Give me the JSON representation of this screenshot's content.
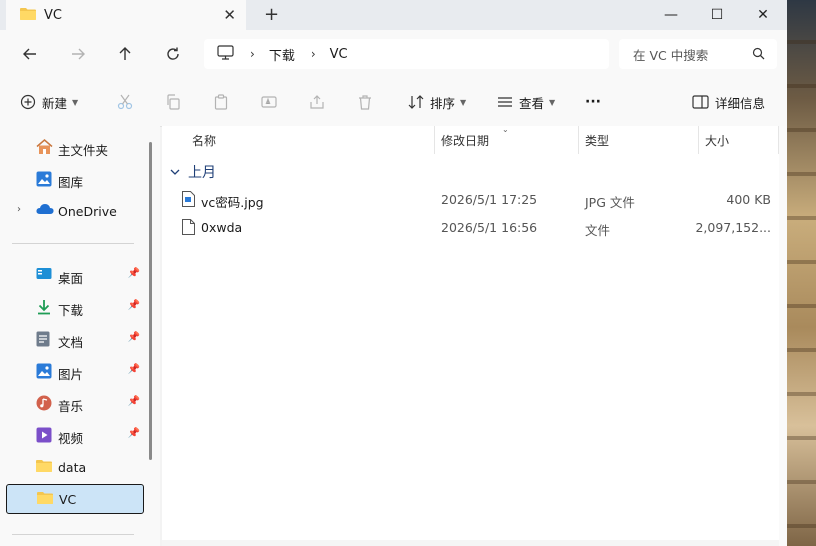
{
  "window": {
    "tab_title": "VC",
    "tab_close": "✕",
    "new_tab": "+",
    "min": "—",
    "max": "☐",
    "close": "✕"
  },
  "address": {
    "crumbs": [
      "下载",
      "VC"
    ],
    "sep": "›"
  },
  "search": {
    "placeholder": "在 VC 中搜索"
  },
  "toolbar": {
    "new_label": "新建",
    "sort_label": "排序",
    "view_label": "查看",
    "more_label": "···",
    "details_label": "详细信息"
  },
  "sidebar": {
    "home": "主文件夹",
    "gallery": "图库",
    "onedrive": "OneDrive",
    "pinned": [
      {
        "label": "桌面"
      },
      {
        "label": "下载"
      },
      {
        "label": "文档"
      },
      {
        "label": "图片"
      },
      {
        "label": "音乐"
      },
      {
        "label": "视频"
      }
    ],
    "folders": [
      {
        "label": "data"
      },
      {
        "label": "VC"
      }
    ]
  },
  "columns": {
    "name": "名称",
    "modified": "修改日期",
    "type": "类型",
    "size": "大小"
  },
  "group": {
    "label": "上月"
  },
  "files": [
    {
      "name": "vc密码.jpg",
      "modified": "2026/5/1 17:25",
      "type": "JPG 文件",
      "size": "400 KB"
    },
    {
      "name": "0xwda",
      "modified": "2026/5/1 16:56",
      "type": "文件",
      "size": "2,097,152..."
    }
  ],
  "colors": {
    "accent": "#0067c0",
    "folder": "#f4c64f",
    "selected": "#cce4f7"
  }
}
